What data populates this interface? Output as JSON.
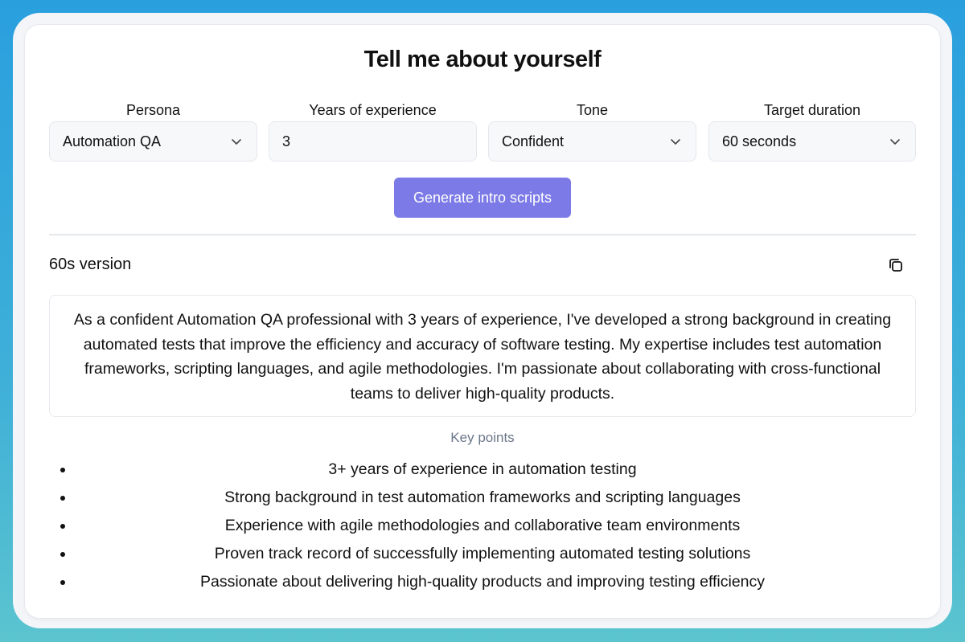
{
  "page": {
    "title": "Tell me about yourself"
  },
  "form": {
    "persona": {
      "label": "Persona",
      "value": "Automation QA"
    },
    "experience": {
      "label": "Years of experience",
      "value": "3"
    },
    "tone": {
      "label": "Tone",
      "value": "Confident"
    },
    "duration": {
      "label": "Target duration",
      "value": "60 seconds"
    },
    "generate_label": "Generate intro scripts"
  },
  "result": {
    "version_label": "60s version",
    "script": "As a confident Automation QA professional with 3 years of experience, I've developed a strong background in creating automated tests that improve the efficiency and accuracy of software testing. My expertise includes test automation frameworks, scripting languages, and agile methodologies. I'm passionate about collaborating with cross-functional teams to deliver high-quality products.",
    "key_points_heading": "Key points",
    "key_points": [
      "3+ years of experience in automation testing",
      "Strong background in test automation frameworks and scripting languages",
      "Experience with agile methodologies and collaborative team environments",
      "Proven track record of successfully implementing automated testing solutions",
      "Passionate about delivering high-quality products and improving testing efficiency"
    ]
  },
  "icons": {
    "dropdown": "chevron-down-icon",
    "copy": "copy-icon"
  },
  "colors": {
    "accent": "#7c7ae6",
    "background_gradient": [
      "#2a9fde",
      "#5bc4cf"
    ],
    "muted_text": "#6b7789"
  }
}
